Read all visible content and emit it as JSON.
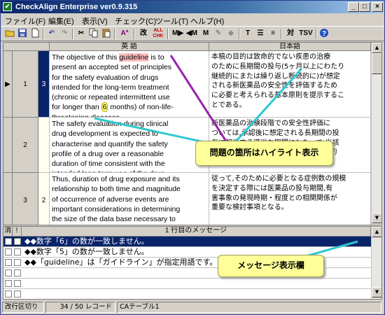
{
  "window": {
    "title": "CheckAlign Enterprise ver0.9.315"
  },
  "menu": [
    "ファイル(F)",
    "編集(E)",
    "表示(V)",
    "チェック(C)",
    "ツール(T)",
    "ヘルプ(H)"
  ],
  "toolbar": {
    "icons": [
      "new-file-icon",
      "open-folder-icon",
      "save-icon",
      "copy-doc-icon",
      "undo-icon",
      "redo-icon",
      "cut-icon",
      "copy-icon",
      "paste-icon",
      "spell-check-icon",
      "check-icon",
      "all-check-icon",
      "m-right-icon",
      "m-left-icon",
      "m-icon",
      "pen-icon",
      "erase-icon",
      "font-icon",
      "align-icon",
      "list-icon",
      "pair-icon",
      "tsv-icon",
      "help-icon"
    ],
    "labels": {
      "check": "改",
      "all_check": "ALL\nCHK",
      "pair": "対",
      "tsv": "TSV",
      "aa": "Aª",
      "m_right": "M▶",
      "m_left": "◀M",
      "m": "M"
    }
  },
  "grid": {
    "headers": {
      "english": "英 語",
      "japanese": "日本語"
    },
    "rows": [
      {
        "num": "1",
        "score": "3",
        "selected": true,
        "en_pre": "The objective of this ",
        "en_hl": "guideline",
        "en_mid": " is to\npresent an accepted set of principles\nfor the safety evaluation of drugs\nintended for the long-term treatment\n(chronic or repeated intermittent use\nfor longer than ",
        "en_num": "6",
        "en_post": " months) of non-life-\nthreatening diseases.",
        "ja": "本稿の目的は致命的でない疾患の治療\nのために長期間の投与(5ヶ月以上にわたり\n継続的にまたは繰り返し断続的に)が想定\nされる新医薬品の安全性を評価するため\nに必要と考えられる基本原則を提示するこ\nとである。"
      },
      {
        "num": "2",
        "score": "",
        "selected": false,
        "en": "The safety evaluation during clinical\ndrug development is expected to\ncharacterise and quantify the safety\nprofile of a drug over a reasonable\nduration of time consistent with the\nintended long-term use of the drug",
        "ja": "新医薬品の治験段階での安全性評価に\nついては,承認後に想定される長期間の投\n与に相当する適当な期間にわたって,当該\n医薬品の安全性を特徴付け、かつ定量的\nに評価することが求められる。"
      },
      {
        "num": "3",
        "score": "2",
        "selected": false,
        "en": "Thus, duration of drug exposure and its\nrelationship to both time and magnitude\nof occurrence of adverse events are\nimportant considerations in determining\nthe size of the data base necessary to\nachieve such goals.",
        "ja": "従って,そのために必要となる症例数の規模\nを決定する際には医薬品の投与期間,有\n害事象の発現時期・程度との相関関係が\n重要な検討事項となる。"
      }
    ]
  },
  "callouts": {
    "highlight": "問題の箇所はハイライト表示",
    "message": "メッセージ表示欄"
  },
  "messages": {
    "col_done": "消",
    "col_flag": "!",
    "title": "1 行目のメッセージ",
    "items": [
      "◆◆数字「6」の数が一致しません。",
      "◆◆数字「5」の数が一致しません。",
      "◆◆「guideline」は「ガイドライン」が指定用語です。"
    ]
  },
  "status": {
    "mode": "改行区切り",
    "record": "34 / 50 レコード",
    "table": "CAテーブル1"
  },
  "colors": {
    "selected_row": "#0a246a",
    "highlight": "#ffc0c0",
    "callout_bg": "#ffff99",
    "arrow_purple": "#9a1fb0",
    "arrow_cyan": "#2ec8d0"
  }
}
